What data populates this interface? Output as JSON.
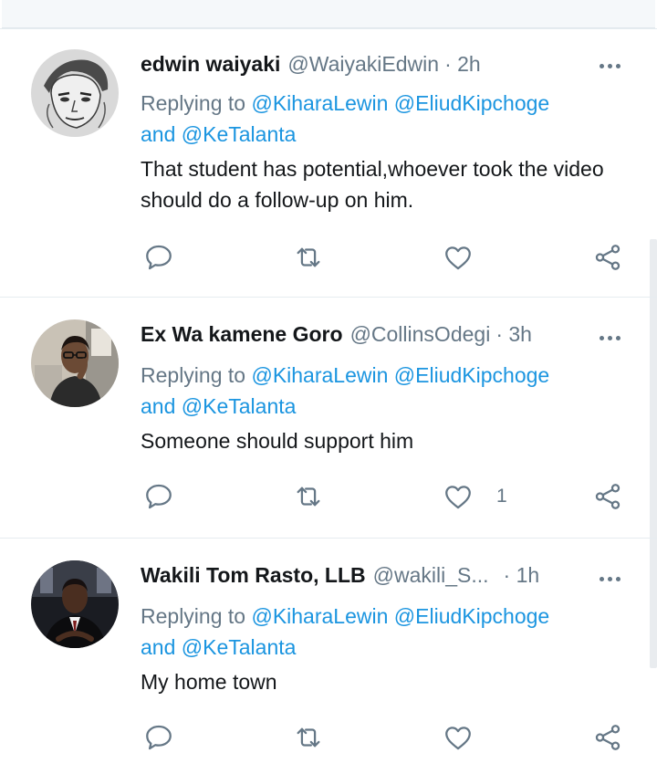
{
  "tweets": [
    {
      "name": "edwin waiyaki",
      "handle": "@WaiyakiEdwin",
      "time": "· 2h",
      "reply_prefix": "Replying to",
      "mention1": "@KiharaLewin",
      "mention2": "@EliudKipchoge",
      "reply_and": "and",
      "mention3": "@KeTalanta",
      "text": "That student has potential,whoever took the video should do a follow-up on him.",
      "like_count": ""
    },
    {
      "name": "Ex Wa kamene Goro",
      "handle": "@CollinsOdegi",
      "time": "· 3h",
      "reply_prefix": "Replying to",
      "mention1": "@KiharaLewin",
      "mention2": "@EliudKipchoge",
      "reply_and": "and",
      "mention3": "@KeTalanta",
      "text": "Someone should support him",
      "like_count": "1"
    },
    {
      "name": "Wakili Tom Rasto, LLB",
      "handle": "@wakili_S...",
      "time": "· 1h",
      "reply_prefix": "Replying to",
      "mention1": "@KiharaLewin",
      "mention2": "@EliudKipchoge",
      "reply_and": "and",
      "mention3": "@KeTalanta",
      "text": "My home town",
      "like_count": ""
    }
  ],
  "colors": {
    "link": "#1b95e0",
    "secondary_text": "#657786",
    "primary_text": "#14171a",
    "icon": "#657786"
  },
  "icons": [
    "reply-icon",
    "retweet-icon",
    "like-icon",
    "share-icon",
    "more-icon"
  ]
}
